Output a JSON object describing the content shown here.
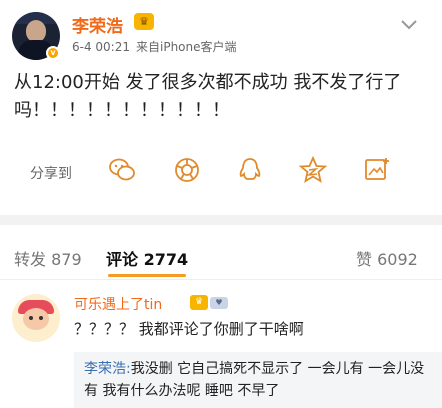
{
  "post": {
    "author": "李荣浩",
    "time": "6-4 00:21",
    "source": "来自iPhone客户端",
    "content": "从12:00开始 发了很多次都不成功 我不发了行了吗！！！！！！！！！！！"
  },
  "share": {
    "label": "分享到",
    "targets": [
      "wechat-icon",
      "moments-icon",
      "qq-icon",
      "qzone-icon",
      "image-share-icon"
    ]
  },
  "tabs": {
    "repost_label": "转发",
    "repost_count": "879",
    "comment_label": "评论",
    "comment_count": "2774",
    "like_label": "赞",
    "like_count": "6092"
  },
  "comment": {
    "author": "可乐遇上了tin",
    "text": "？？？？ 我都评论了你删了干啥啊",
    "reply_author": "李荣浩:",
    "reply_text": "我没删 它自己搞死不显示了 一会儿有 一会儿没有 我有什么办法呢 睡吧 不早了"
  },
  "colors": {
    "accent": "#f06a1a",
    "link": "#3a6fb3",
    "tab_underline": "#f59b23"
  }
}
